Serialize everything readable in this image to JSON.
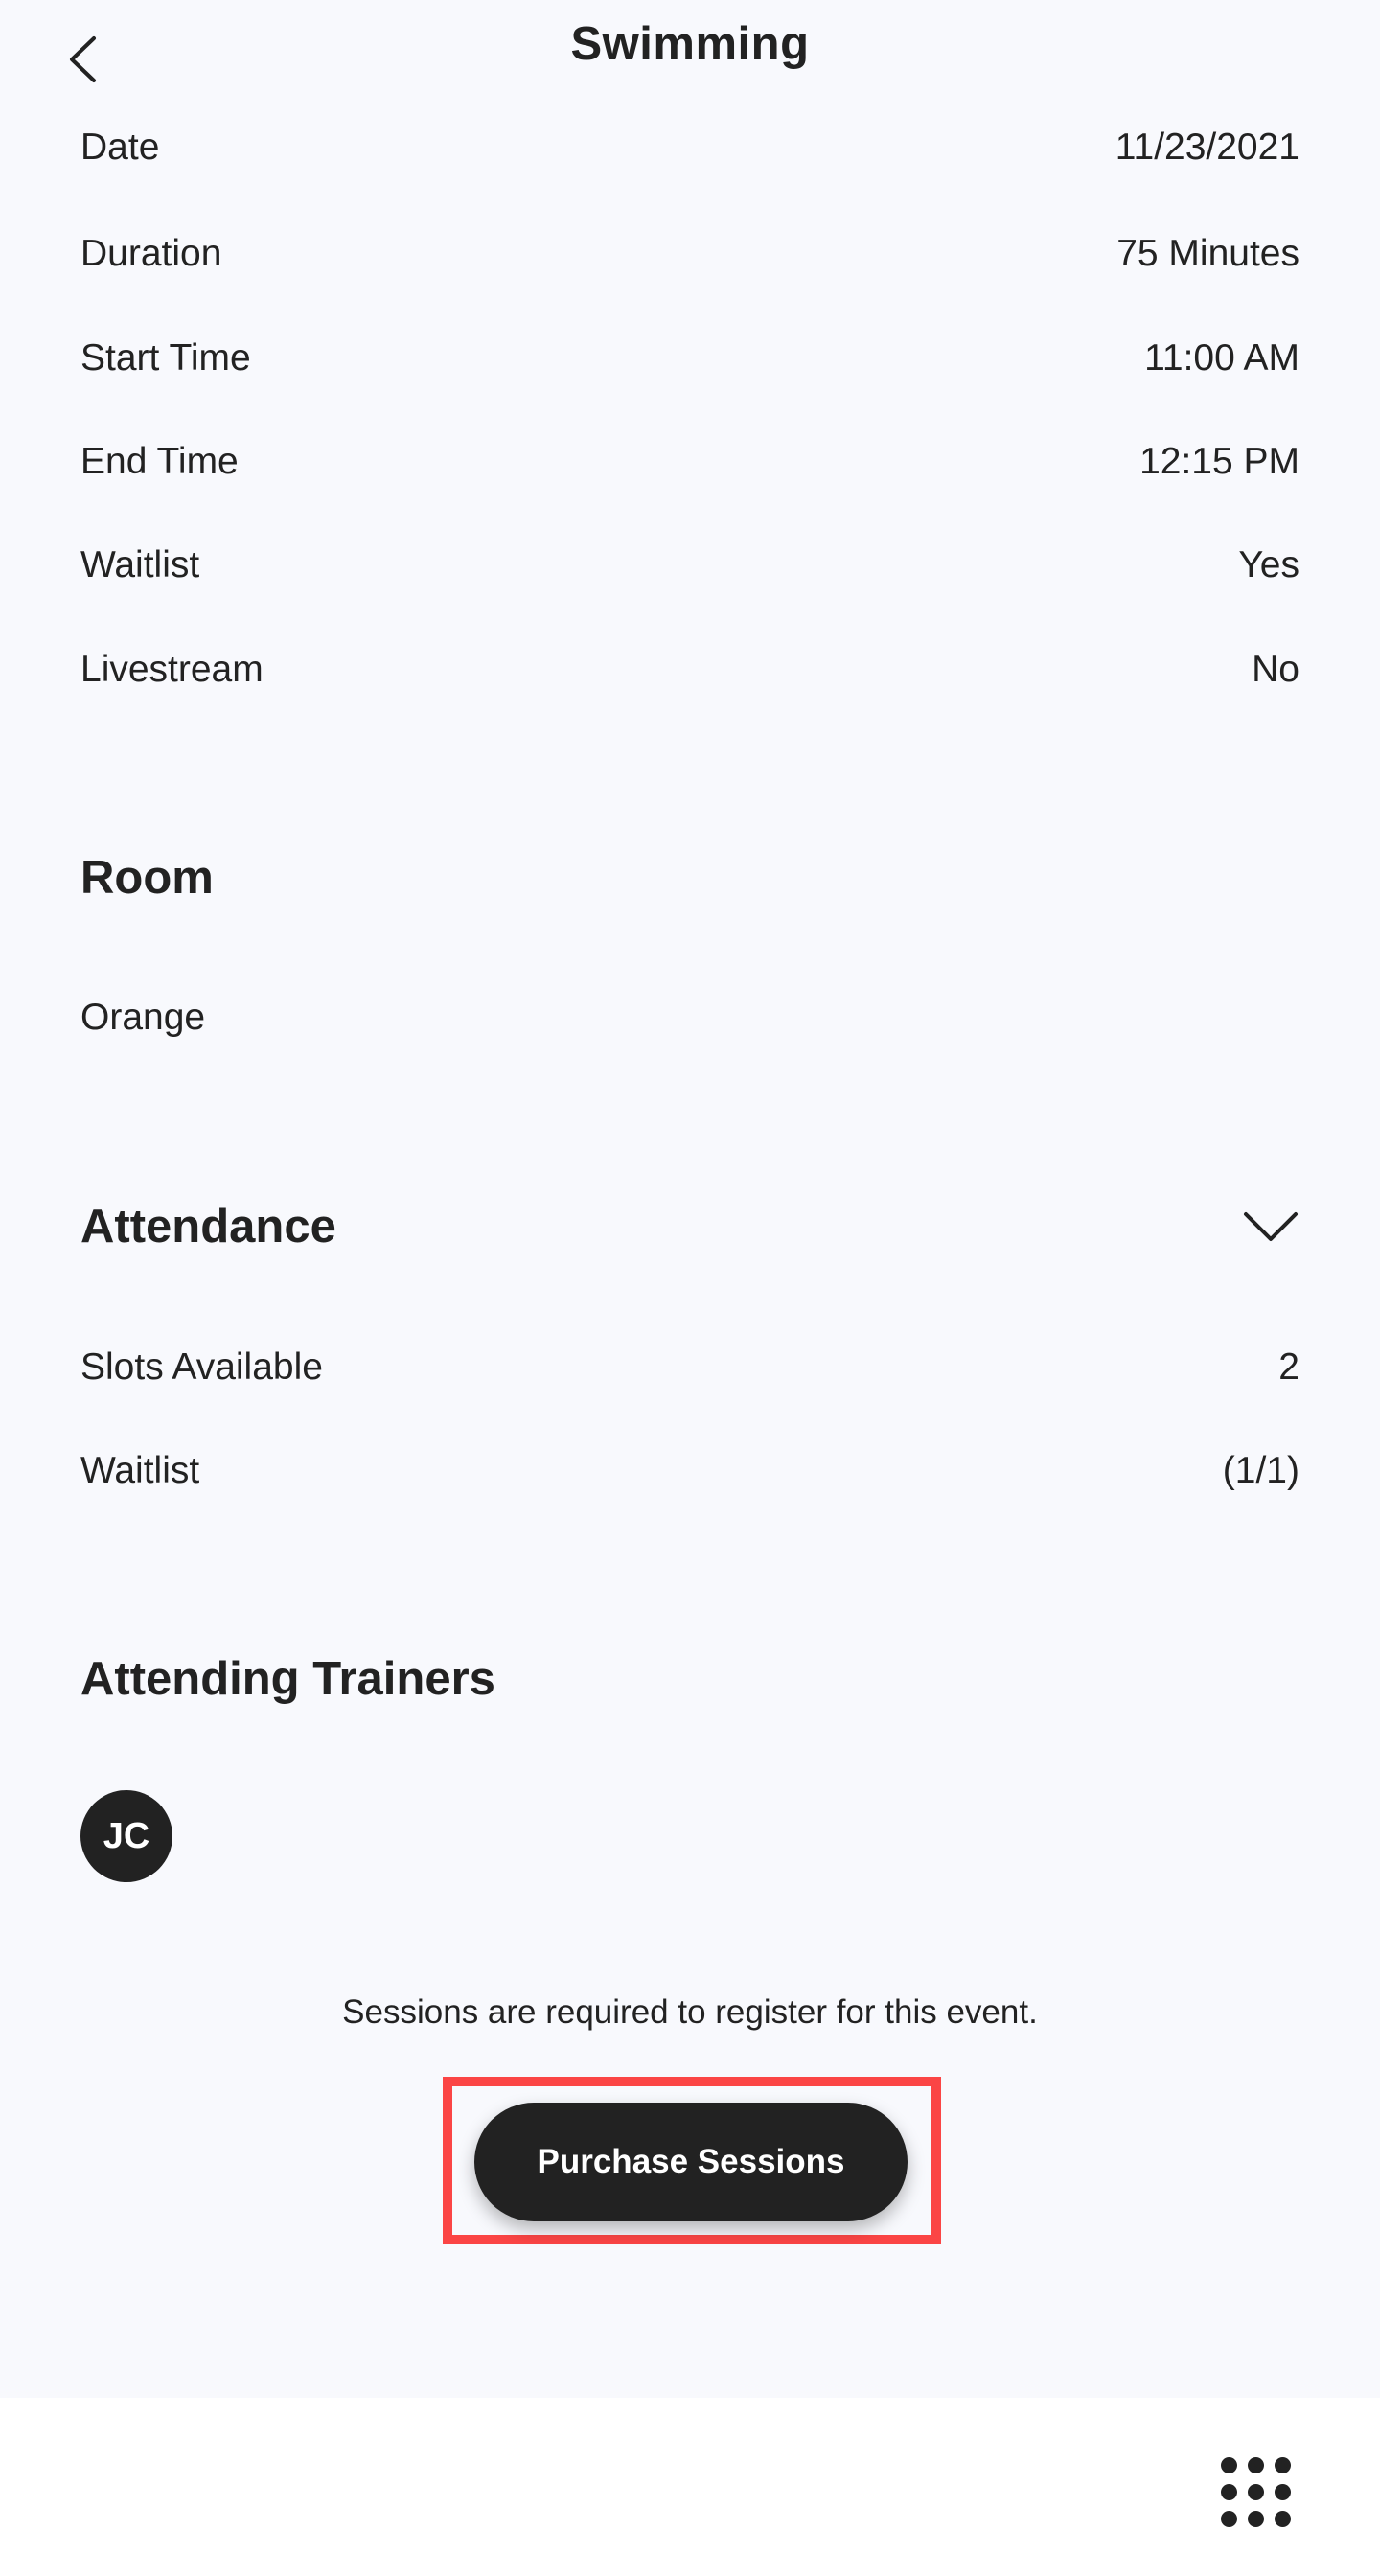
{
  "header": {
    "title": "Swimming"
  },
  "details": [
    {
      "label": "Date",
      "value": "11/23/2021"
    },
    {
      "label": "Duration",
      "value": "75 Minutes"
    },
    {
      "label": "Start Time",
      "value": "11:00 AM"
    },
    {
      "label": "End Time",
      "value": "12:15 PM"
    },
    {
      "label": "Waitlist",
      "value": "Yes"
    },
    {
      "label": "Livestream",
      "value": "No"
    }
  ],
  "room": {
    "title": "Room",
    "value": "Orange"
  },
  "attendance": {
    "title": "Attendance",
    "rows": [
      {
        "label": "Slots Available",
        "value": "2"
      },
      {
        "label": "Waitlist",
        "value": "(1/1)"
      }
    ]
  },
  "trainers": {
    "title": "Attending Trainers",
    "avatar_initials": "JC"
  },
  "notice": "Sessions are required to register for this event.",
  "purchase_button": {
    "label": "Purchase Sessions",
    "highlight_color": "#fb4545"
  },
  "icons": {
    "back": "chevron-left-icon",
    "expand": "chevron-down-icon",
    "menu": "grid-dots-icon"
  }
}
